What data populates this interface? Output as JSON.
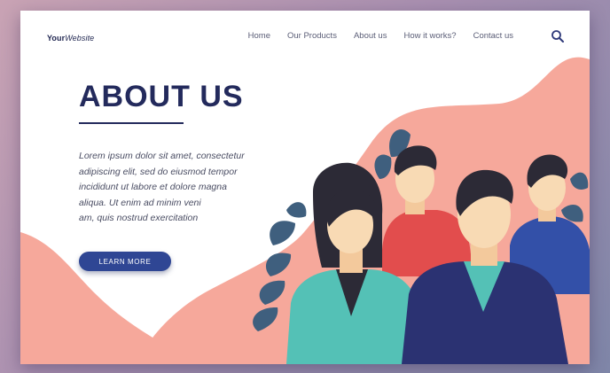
{
  "header": {
    "logo_bold": "Your",
    "logo_italic": "Website",
    "nav": [
      "Home",
      "Our Products",
      "About us",
      "How it works?",
      "Contact us"
    ]
  },
  "icons": {
    "search": "search-icon"
  },
  "hero": {
    "title": "ABOUT US",
    "body": "Lorem ipsum dolor sit amet, consectetur\nadipiscing elit, sed do eiusmod tempor\nincididunt ut labore et dolore magna\naliqua. Ut enim ad minim veni\nam, quis nostrud exercitation",
    "cta_label": "LEARN MORE"
  },
  "colors": {
    "navy": "#232a5c",
    "blob": "#f6a89b",
    "button": "#2f4694",
    "leaf": "#3f5f7e"
  }
}
